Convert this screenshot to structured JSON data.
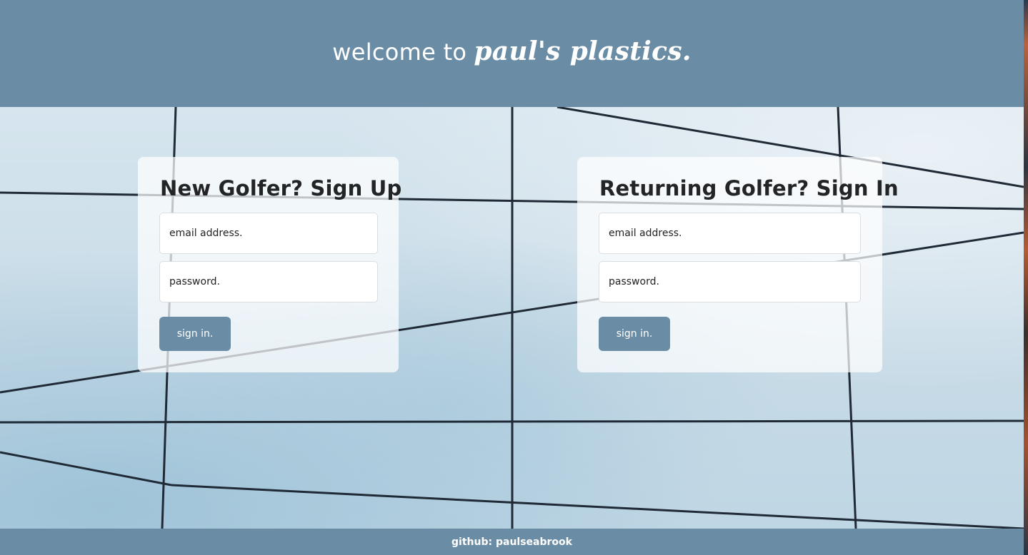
{
  "header": {
    "welcome_text": "welcome to",
    "brand_text": "paul's plastics."
  },
  "signup": {
    "title": "New Golfer? Sign Up",
    "email_placeholder": "email address.",
    "password_placeholder": "password.",
    "button_label": "sign in."
  },
  "signin": {
    "title": "Returning Golfer? Sign In",
    "email_placeholder": "email address.",
    "password_placeholder": "password.",
    "button_label": "sign in."
  },
  "footer": {
    "text": "github: paulseabrook"
  },
  "colors": {
    "header_bg": "#6a8da5",
    "button_bg": "#6a8da5",
    "footer_bg": "#6a8da5"
  }
}
